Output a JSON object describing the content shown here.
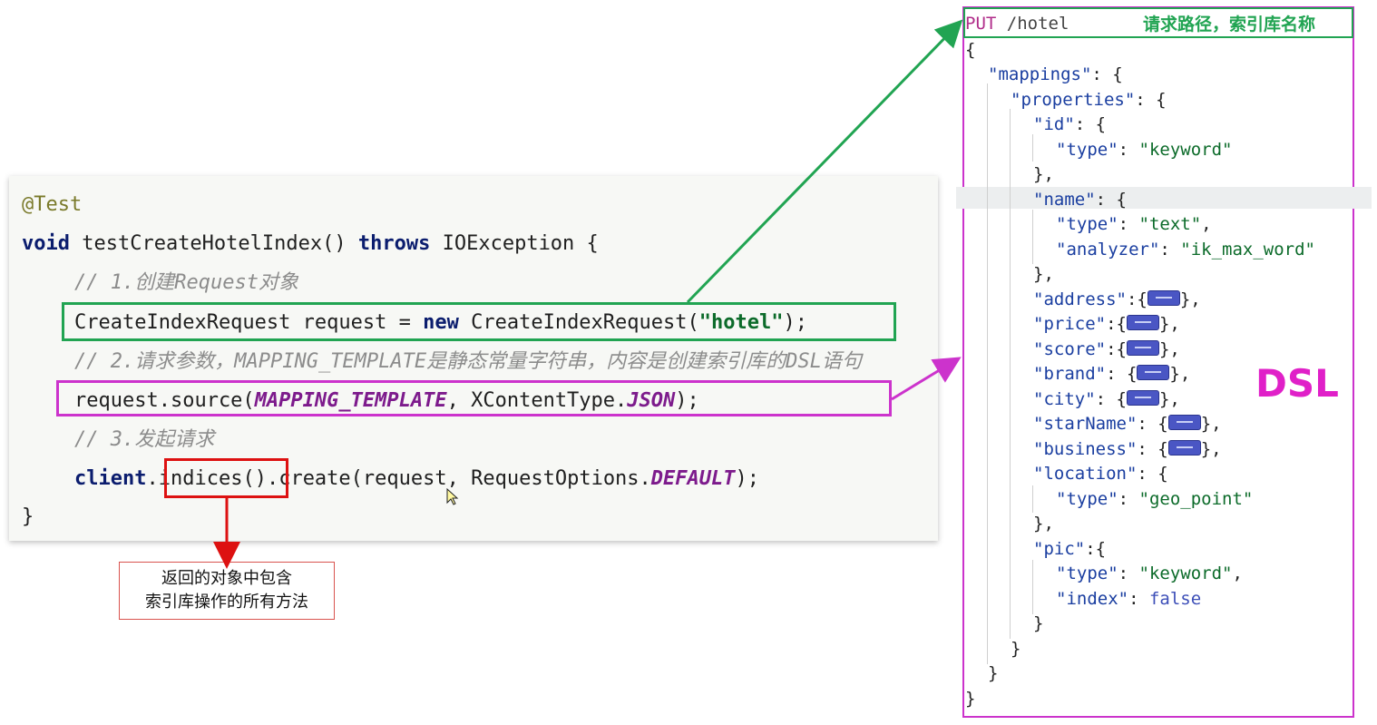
{
  "code": {
    "annotation": "@Test",
    "signature": {
      "kw_void": "void",
      "method": " testCreateHotelIndex() ",
      "kw_throws": "throws",
      "rest": " IOException {"
    },
    "comment1": "// 1.创建Request对象",
    "line_request": {
      "p1": "CreateIndexRequest request = ",
      "kw_new": "new",
      "p2": " CreateIndexRequest(",
      "str": "\"hotel\"",
      "p3": ");"
    },
    "comment2": "// 2.请求参数，MAPPING_TEMPLATE是静态常量字符串，内容是创建索引库的DSL语句",
    "line_source": {
      "p1": "request.source(",
      "const1": "MAPPING_TEMPLATE",
      "p2": ", XContentType.",
      "const2": "JSON",
      "p3": ");"
    },
    "comment3": "// 3.发起请求",
    "line_client": {
      "kw_client": "client",
      "p1": ".",
      "indices": "indices()",
      "p2": ".create(request, RequestOptions.",
      "const": "DEFAULT",
      "p3": ");"
    },
    "close": "}"
  },
  "callout": {
    "line1": "返回的对象中包含",
    "line2": "索引库操作的所有方法"
  },
  "dsl": {
    "method": "PUT",
    "path": " /hotel",
    "header_label": "请求路径，索引库名称",
    "badge": "DSL",
    "lines": {
      "l0": "{",
      "l1_key": "\"mappings\"",
      "l1_rest": ": {",
      "l2_key": "\"properties\"",
      "l2_rest": ": {",
      "id_key": "\"id\"",
      "id_rest": ": {",
      "id_type_key": "\"type\"",
      "id_type_val": "\"keyword\"",
      "id_close": "},",
      "name_key": "\"name\"",
      "name_rest": ": {",
      "name_type_key": "\"type\"",
      "name_type_val": "\"text\"",
      "name_an_key": "\"analyzer\"",
      "name_an_val": "\"ik_max_word\"",
      "name_close": "},",
      "address_key": "\"address\"",
      "price_key": "\"price\"",
      "score_key": "\"score\"",
      "brand_key": "\"brand\"",
      "city_key": "\"city\"",
      "starName_key": "\"starName\"",
      "business_key": "\"business\"",
      "location_key": "\"location\"",
      "location_rest": ": {",
      "loc_type_key": "\"type\"",
      "loc_type_val": "\"geo_point\"",
      "loc_close": "},",
      "pic_key": "\"pic\"",
      "pic_rest": ":{",
      "pic_type_key": "\"type\"",
      "pic_type_val": "\"keyword\"",
      "pic_index_key": "\"index\"",
      "pic_index_val": "false",
      "close1": "}",
      "close2": "}",
      "close3": "}",
      "close4": "}"
    }
  },
  "colors": {
    "green": "#21a452",
    "magenta": "#cc33cc",
    "red": "#dd1111"
  }
}
